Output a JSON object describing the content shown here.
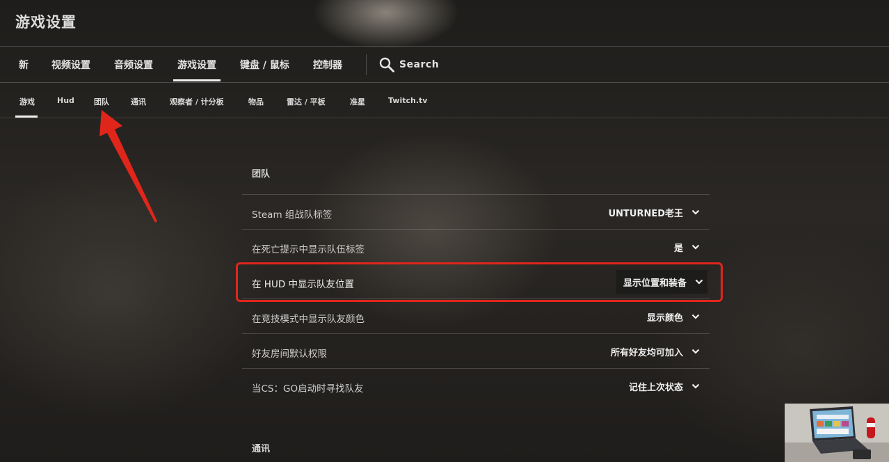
{
  "header": {
    "title": "游戏设置"
  },
  "main_tabs": [
    {
      "label": "新"
    },
    {
      "label": "视频设置"
    },
    {
      "label": "音频设置"
    },
    {
      "label": "游戏设置",
      "active": true
    },
    {
      "label": "键盘 / 鼠标"
    },
    {
      "label": "控制器"
    }
  ],
  "search": {
    "label": "Search",
    "icon": "search-icon"
  },
  "sub_tabs": [
    {
      "label": "游戏",
      "active": true
    },
    {
      "label": "Hud"
    },
    {
      "label": "团队"
    },
    {
      "label": "通讯"
    },
    {
      "label": "观察者 / 计分板"
    },
    {
      "label": "物品"
    },
    {
      "label": "雷达 / 平板"
    },
    {
      "label": "准星"
    },
    {
      "label": "Twitch.tv"
    }
  ],
  "sections": [
    {
      "title": "团队",
      "rows": [
        {
          "label": "Steam 组战队标签",
          "value": "UNTURNED老王"
        },
        {
          "label": "在死亡提示中显示队伍标签",
          "value": "是"
        },
        {
          "label": "在 HUD 中显示队友位置",
          "value": "显示位置和装备",
          "highlighted": true
        },
        {
          "label": "在竞技模式中显示队友颜色",
          "value": "显示颜色"
        },
        {
          "label": "好友房间默认权限",
          "value": "所有好友均可加入"
        },
        {
          "label": "当CS：GO启动时寻找队友",
          "value": "记住上次状态"
        }
      ]
    },
    {
      "title": "通讯"
    }
  ],
  "annotation": {
    "box_color": "#e0261b",
    "arrow_color": "#e0261b"
  }
}
